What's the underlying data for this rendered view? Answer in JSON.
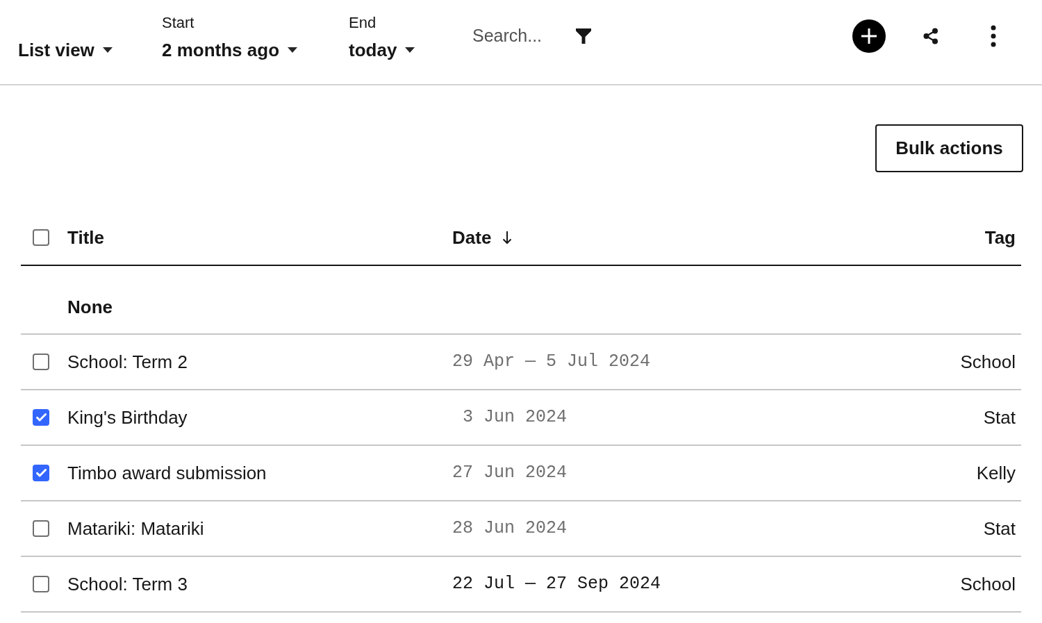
{
  "toolbar": {
    "view_dropdown": {
      "value": "List view"
    },
    "start": {
      "label": "Start",
      "value": "2 months ago"
    },
    "end": {
      "label": "End",
      "value": "today"
    },
    "search": {
      "placeholder": "Search..."
    }
  },
  "bulk_actions": {
    "label": "Bulk actions"
  },
  "table": {
    "select_all": {
      "checked": false
    },
    "columns": [
      {
        "label": "Title"
      },
      {
        "label": "Date",
        "sort_descending": true
      },
      {
        "label": "Tag"
      }
    ],
    "groups": [
      {
        "label": "None",
        "rows": [
          {
            "title": "School: Term 2",
            "date": "29 Apr — 5 Jul 2024",
            "tag": "School",
            "checked": false,
            "past": true
          },
          {
            "title": "King's Birthday",
            "date": " 3 Jun 2024",
            "tag": "Stat",
            "checked": true,
            "past": true
          },
          {
            "title": "Timbo award submission",
            "date": "27 Jun 2024",
            "tag": "Kelly",
            "checked": true,
            "past": true
          },
          {
            "title": "Matariki: Matariki",
            "date": "28 Jun 2024",
            "tag": "Stat",
            "checked": false,
            "past": true
          },
          {
            "title": "School: Term 3",
            "date": "22 Jul — 27 Sep 2024",
            "tag": "School",
            "checked": false,
            "past": false
          }
        ]
      }
    ]
  }
}
